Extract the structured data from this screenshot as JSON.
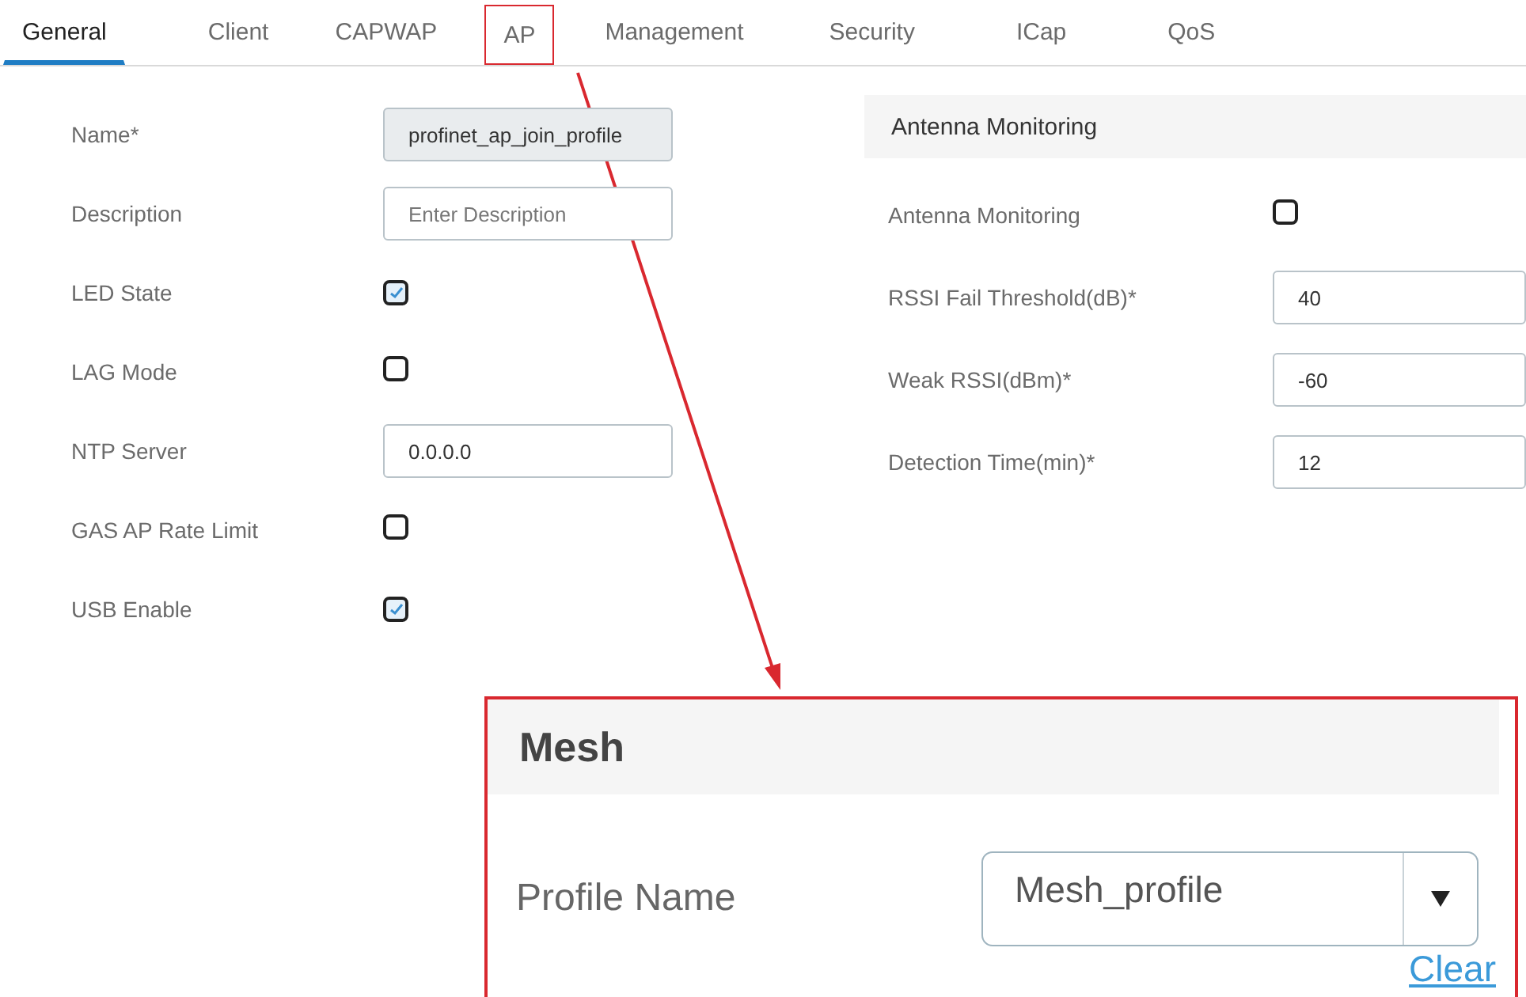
{
  "tabs": [
    {
      "label": "General",
      "selected": true,
      "highlighted": false
    },
    {
      "label": "Client",
      "selected": false,
      "highlighted": false
    },
    {
      "label": "CAPWAP",
      "selected": false,
      "highlighted": false
    },
    {
      "label": "AP",
      "selected": false,
      "highlighted": true
    },
    {
      "label": "Management",
      "selected": false,
      "highlighted": false
    },
    {
      "label": "Security",
      "selected": false,
      "highlighted": false
    },
    {
      "label": "ICap",
      "selected": false,
      "highlighted": false
    },
    {
      "label": "QoS",
      "selected": false,
      "highlighted": false
    }
  ],
  "general_fields": [
    {
      "kind": "readonly",
      "label": "Name*",
      "value": "profinet_ap_join_profile"
    },
    {
      "kind": "text",
      "label": "Description",
      "placeholder": "Enter Description"
    },
    {
      "kind": "checkbox",
      "label": "LED State",
      "checked": true
    },
    {
      "kind": "checkbox",
      "label": "LAG Mode",
      "checked": false
    },
    {
      "kind": "text",
      "label": "NTP Server",
      "value": "0.0.0.0"
    },
    {
      "kind": "checkbox",
      "label": "GAS AP Rate Limit",
      "checked": false
    },
    {
      "kind": "checkbox",
      "label": "USB Enable",
      "checked": true
    }
  ],
  "antenna_monitoring": {
    "title": "Antenna Monitoring",
    "fields": [
      {
        "kind": "checkbox",
        "label": "Antenna Monitoring",
        "checked": false
      },
      {
        "kind": "text",
        "label": "RSSI Fail Threshold(dB)*",
        "value": "40"
      },
      {
        "kind": "text",
        "label": "Weak RSSI(dBm)*",
        "value": "-60"
      },
      {
        "kind": "text",
        "label": "Detection Time(min)*",
        "value": "12"
      }
    ]
  },
  "mesh": {
    "title": "Mesh",
    "profile_label": "Profile Name",
    "profile_value": "Mesh_profile",
    "clear_link": "Clear"
  }
}
